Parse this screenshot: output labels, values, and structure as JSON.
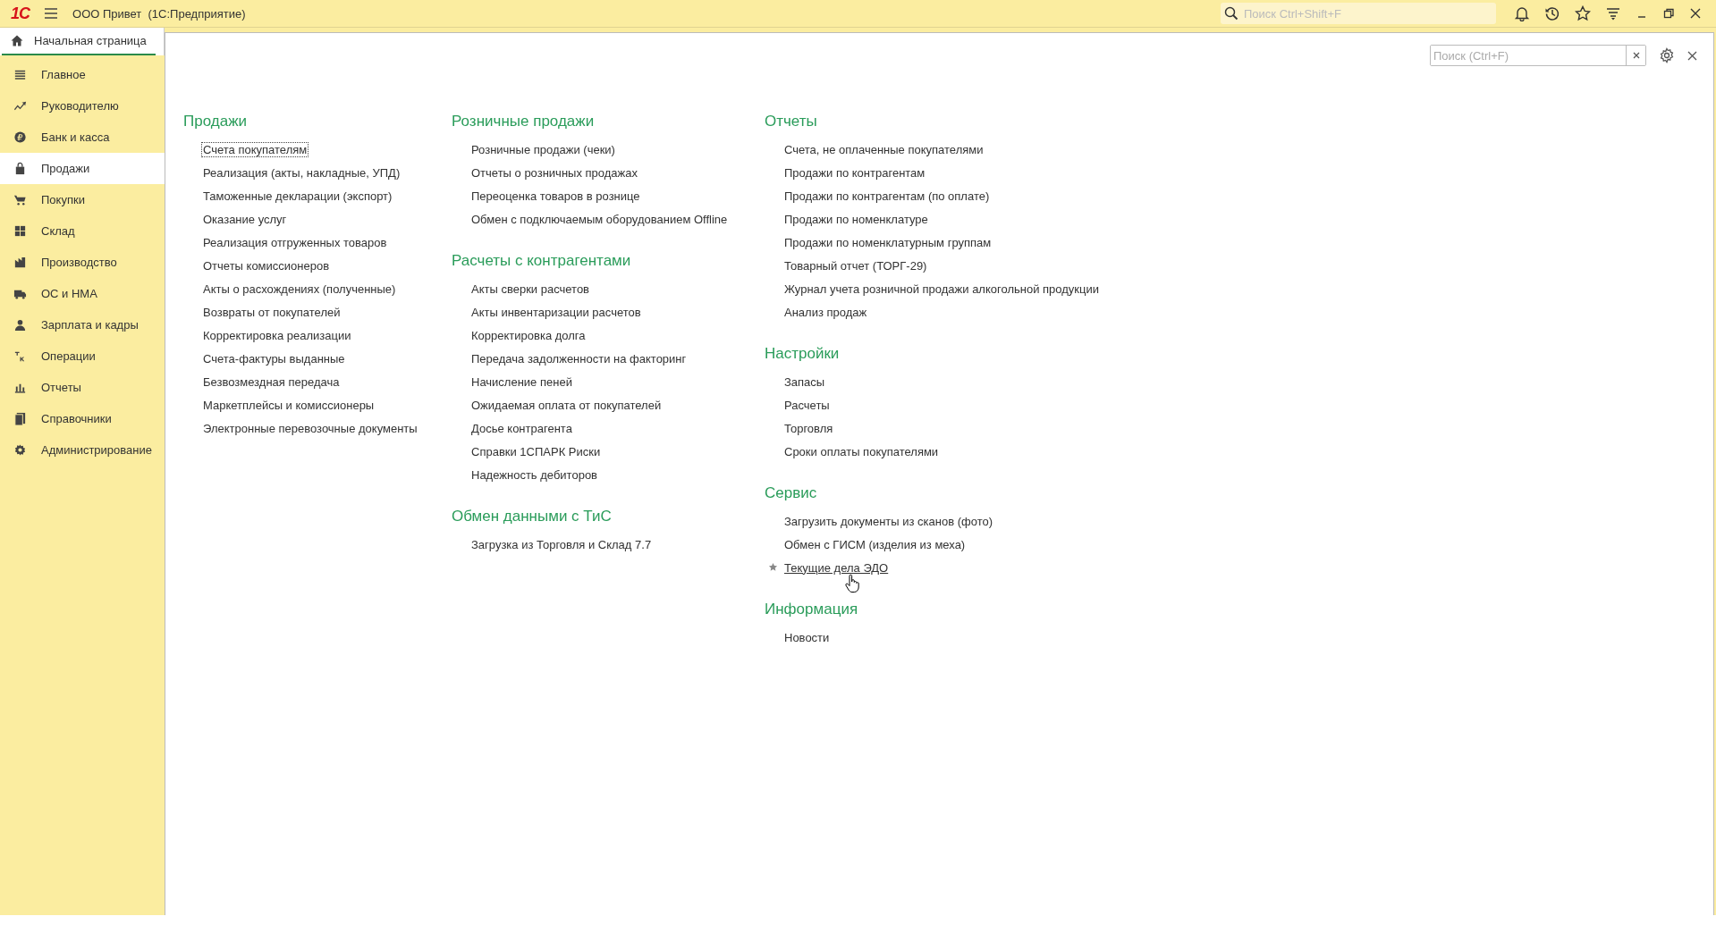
{
  "top_bar": {
    "logo": "1С",
    "title": "ООО Привет  (1С:Предприятие)",
    "search": {
      "placeholder": "Поиск Ctrl+Shift+F"
    }
  },
  "tabs": [
    {
      "label": "Начальная страница",
      "selected": true
    }
  ],
  "sidebar": {
    "items": [
      {
        "label": "Главное",
        "selected": false
      },
      {
        "label": "Руководителю",
        "selected": false
      },
      {
        "label": "Банк и касса",
        "selected": false
      },
      {
        "label": "Продажи",
        "selected": true
      },
      {
        "label": "Покупки",
        "selected": false
      },
      {
        "label": "Склад",
        "selected": false
      },
      {
        "label": "Производство",
        "selected": false
      },
      {
        "label": "ОС и НМА",
        "selected": false
      },
      {
        "label": "Зарплата и кадры",
        "selected": false
      },
      {
        "label": "Операции",
        "selected": false
      },
      {
        "label": "Отчеты",
        "selected": false
      },
      {
        "label": "Справочники",
        "selected": false
      },
      {
        "label": "Администрирование",
        "selected": false
      }
    ]
  },
  "content": {
    "search": {
      "placeholder": "Поиск (Ctrl+F)"
    },
    "columns": [
      [
        {
          "title": "Продажи",
          "items": [
            {
              "label": "Счета покупателям",
              "focused": true,
              "favorite": false,
              "hovered": false
            },
            {
              "label": "Реализация (акты, накладные, УПД)",
              "focused": false,
              "favorite": false,
              "hovered": false
            },
            {
              "label": "Таможенные декларации (экспорт)",
              "focused": false,
              "favorite": false,
              "hovered": false
            },
            {
              "label": "Оказание услуг",
              "focused": false,
              "favorite": false,
              "hovered": false
            },
            {
              "label": "Реализация отгруженных товаров",
              "focused": false,
              "favorite": false,
              "hovered": false
            },
            {
              "label": "Отчеты комиссионеров",
              "focused": false,
              "favorite": false,
              "hovered": false
            },
            {
              "label": "Акты о расхождениях (полученные)",
              "focused": false,
              "favorite": false,
              "hovered": false
            },
            {
              "label": "Возвраты от покупателей",
              "focused": false,
              "favorite": false,
              "hovered": false
            },
            {
              "label": "Корректировка реализации",
              "focused": false,
              "favorite": false,
              "hovered": false
            },
            {
              "label": "Счета-фактуры выданные",
              "focused": false,
              "favorite": false,
              "hovered": false
            },
            {
              "label": "Безвозмездная передача",
              "focused": false,
              "favorite": false,
              "hovered": false
            },
            {
              "label": "Маркетплейсы и комиссионеры",
              "focused": false,
              "favorite": false,
              "hovered": false
            },
            {
              "label": "Электронные перевозочные документы",
              "focused": false,
              "favorite": false,
              "hovered": false
            }
          ]
        }
      ],
      [
        {
          "title": "Розничные продажи",
          "items": [
            {
              "label": "Розничные продажи (чеки)",
              "focused": false,
              "favorite": false,
              "hovered": false
            },
            {
              "label": "Отчеты о розничных продажах",
              "focused": false,
              "favorite": false,
              "hovered": false
            },
            {
              "label": "Переоценка товаров в рознице",
              "focused": false,
              "favorite": false,
              "hovered": false
            },
            {
              "label": "Обмен с подключаемым оборудованием Offline",
              "focused": false,
              "favorite": false,
              "hovered": false
            }
          ]
        },
        {
          "title": "Расчеты с контрагентами",
          "items": [
            {
              "label": "Акты сверки расчетов",
              "focused": false,
              "favorite": false,
              "hovered": false
            },
            {
              "label": "Акты инвентаризации расчетов",
              "focused": false,
              "favorite": false,
              "hovered": false
            },
            {
              "label": "Корректировка долга",
              "focused": false,
              "favorite": false,
              "hovered": false
            },
            {
              "label": "Передача задолженности на факторинг",
              "focused": false,
              "favorite": false,
              "hovered": false
            },
            {
              "label": "Начисление пеней",
              "focused": false,
              "favorite": false,
              "hovered": false
            },
            {
              "label": "Ожидаемая оплата от покупателей",
              "focused": false,
              "favorite": false,
              "hovered": false
            },
            {
              "label": "Досье контрагента",
              "focused": false,
              "favorite": false,
              "hovered": false
            },
            {
              "label": "Справки 1СПАРК Риски",
              "focused": false,
              "favorite": false,
              "hovered": false
            },
            {
              "label": "Надежность дебиторов",
              "focused": false,
              "favorite": false,
              "hovered": false
            }
          ]
        },
        {
          "title": "Обмен данными с ТиС",
          "items": [
            {
              "label": "Загрузка из Торговля и Склад 7.7",
              "focused": false,
              "favorite": false,
              "hovered": false
            }
          ]
        }
      ],
      [
        {
          "title": "Отчеты",
          "items": [
            {
              "label": "Счета, не оплаченные покупателями",
              "focused": false,
              "favorite": false,
              "hovered": false
            },
            {
              "label": "Продажи по контрагентам",
              "focused": false,
              "favorite": false,
              "hovered": false
            },
            {
              "label": "Продажи по контрагентам (по оплате)",
              "focused": false,
              "favorite": false,
              "hovered": false
            },
            {
              "label": "Продажи по номенклатуре",
              "focused": false,
              "favorite": false,
              "hovered": false
            },
            {
              "label": "Продажи по номенклатурным группам",
              "focused": false,
              "favorite": false,
              "hovered": false
            },
            {
              "label": "Товарный отчет (ТОРГ-29)",
              "focused": false,
              "favorite": false,
              "hovered": false
            },
            {
              "label": "Журнал учета розничной продажи алкогольной продукции",
              "focused": false,
              "favorite": false,
              "hovered": false
            },
            {
              "label": "Анализ продаж",
              "focused": false,
              "favorite": false,
              "hovered": false
            }
          ]
        },
        {
          "title": "Настройки",
          "items": [
            {
              "label": "Запасы",
              "focused": false,
              "favorite": false,
              "hovered": false
            },
            {
              "label": "Расчеты",
              "focused": false,
              "favorite": false,
              "hovered": false
            },
            {
              "label": "Торговля",
              "focused": false,
              "favorite": false,
              "hovered": false
            },
            {
              "label": "Сроки оплаты покупателями",
              "focused": false,
              "favorite": false,
              "hovered": false
            }
          ]
        },
        {
          "title": "Сервис",
          "items": [
            {
              "label": "Загрузить документы из сканов (фото)",
              "focused": false,
              "favorite": false,
              "hovered": false
            },
            {
              "label": "Обмен с ГИСМ (изделия из меха)",
              "focused": false,
              "favorite": false,
              "hovered": false
            },
            {
              "label": "Текущие дела ЭДО",
              "focused": false,
              "favorite": true,
              "hovered": true
            }
          ]
        },
        {
          "title": "Информация",
          "items": [
            {
              "label": "Новости",
              "focused": false,
              "favorite": false,
              "hovered": false
            }
          ]
        }
      ]
    ]
  }
}
